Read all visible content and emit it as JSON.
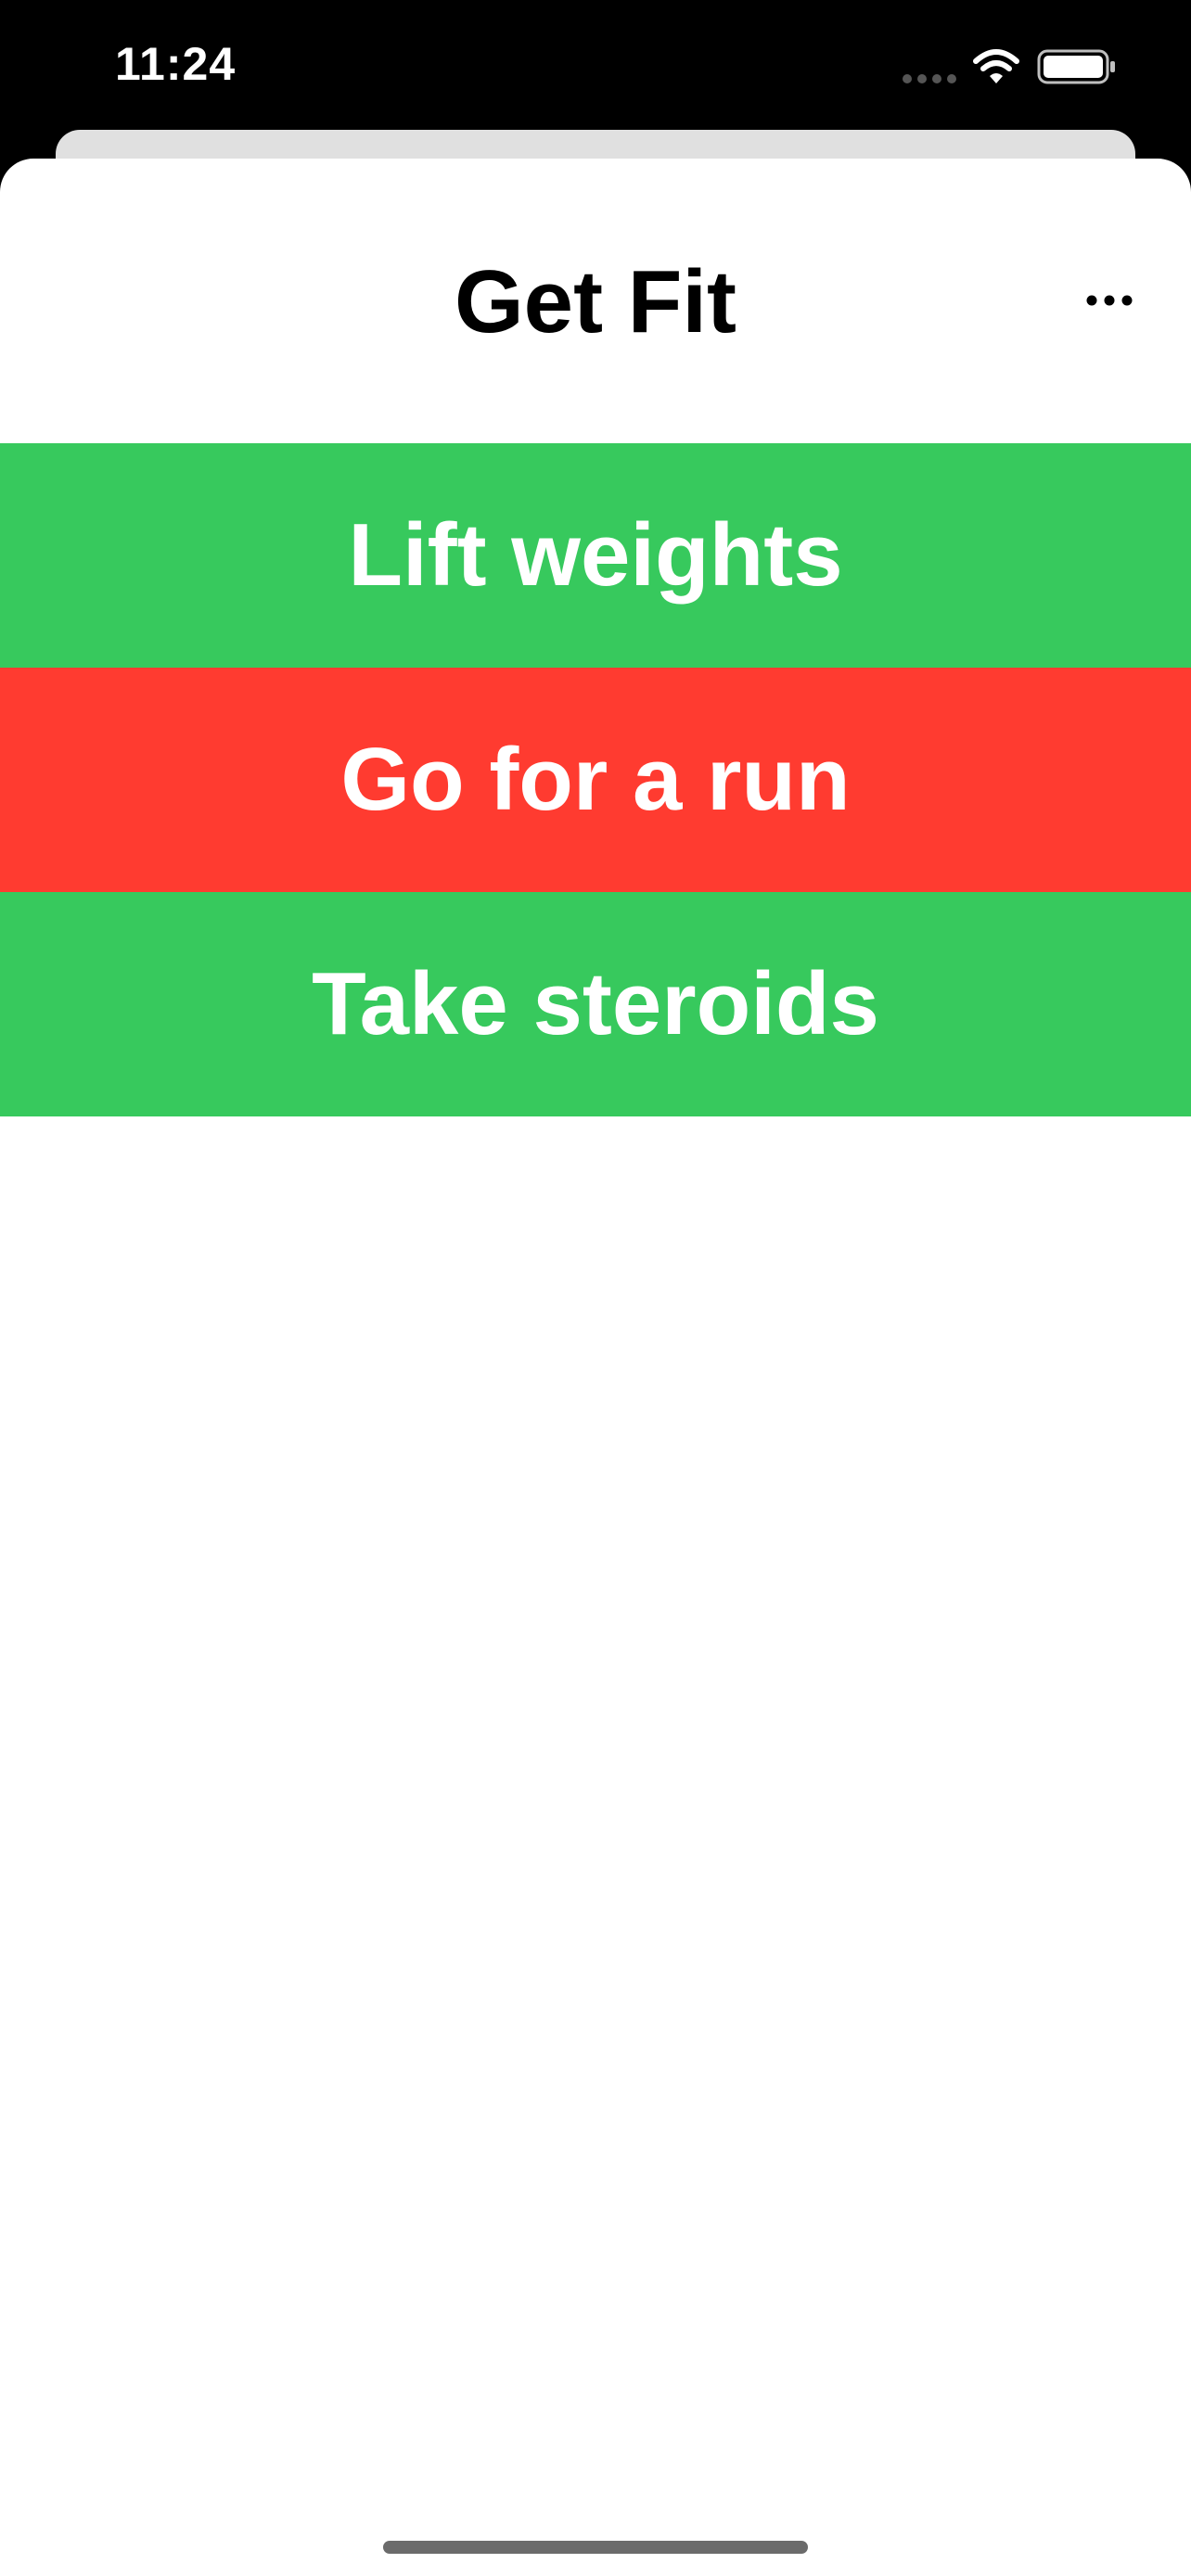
{
  "status_bar": {
    "time": "11:24",
    "icons": [
      "cellular-signal-icon",
      "wifi-icon",
      "battery-icon"
    ]
  },
  "nav": {
    "title": "Get Fit",
    "more_icon": "ellipsis-icon"
  },
  "actions": [
    {
      "label": "Lift weights",
      "color": "#37c95d"
    },
    {
      "label": "Go for a run",
      "color": "#ff3b30"
    },
    {
      "label": "Take steroids",
      "color": "#37c95d"
    }
  ],
  "colors": {
    "background": "#000000",
    "sheet": "#ffffff",
    "green": "#37c95d",
    "red": "#ff3b30"
  }
}
